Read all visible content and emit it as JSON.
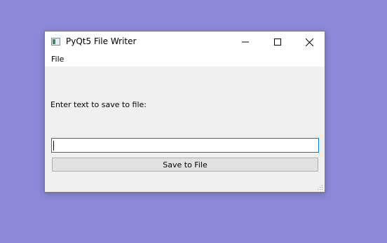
{
  "window": {
    "title": "PyQt5 File Writer",
    "app_icon": "pyqt-app-icon",
    "controls": [
      "minimize-icon",
      "maximize-icon",
      "close-icon"
    ]
  },
  "menubar": {
    "items": [
      {
        "label": "File"
      }
    ]
  },
  "main": {
    "prompt_label": "Enter text to save to file:",
    "input_value": "",
    "input_placeholder": "",
    "save_button_label": "Save to File"
  },
  "colors": {
    "desktop": "#8c8ad8",
    "window_bg": "#f0f0f0",
    "titlebar_bg": "#ffffff",
    "input_focus_border": "#0078d7",
    "button_bg": "#e1e1e1"
  }
}
